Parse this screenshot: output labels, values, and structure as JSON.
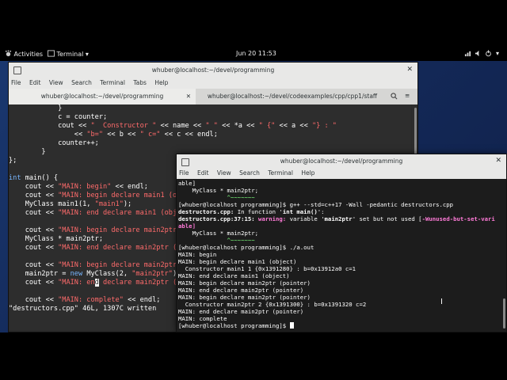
{
  "topbar": {
    "activities": "Activities",
    "app_menu": "Terminal ▾",
    "clock": "Jun 20  11:53"
  },
  "window1": {
    "title": "whuber@localhost:~/devel/programming",
    "menu": [
      "File",
      "Edit",
      "View",
      "Search",
      "Terminal",
      "Tabs",
      "Help"
    ],
    "tabs": [
      {
        "label": "whuber@localhost:~/devel/programming"
      },
      {
        "label": "whuber@localhost:~/devel/codeexamples/cpp/cpp1/staff"
      }
    ],
    "code_lines": [
      "            }",
      "            c = counter;",
      "            cout << \"  Constructor \" << name << \" \" << *a << \" {\" << a << \"} : \"",
      "                << \"b=\" << b << \" c=\" << c << endl;",
      "            counter++;",
      "        }",
      "};",
      "",
      "int main() {",
      "    cout << \"MAIN: begin\" << endl;",
      "    cout << \"MAIN: begin declare main1 (object)\" << endl;",
      "    MyClass main1(1, \"main1\");",
      "    cout << \"MAIN: end declare main1 (object)\" << endl;",
      "",
      "    cout << \"MAIN: begin declare main2ptr (pointer)\" << endl;",
      "    MyClass * main2ptr;",
      "    cout << \"MAIN: end declare main2ptr (pointer)\" << endl;",
      "",
      "    cout << \"MAIN: begin declare main2ptr (pointer)\" << endl;",
      "    main2ptr = new MyClass(2, \"main2ptr\");",
      "    cout << \"MAIN: end declare main2ptr (pointer)\" << endl;",
      "",
      "    cout << \"MAIN: complete\" << endl;",
      "\"destructors.cpp\" 46L, 1307C written"
    ]
  },
  "window2": {
    "title": "whuber@localhost:~/devel/programming",
    "menu": [
      "File",
      "Edit",
      "View",
      "Search",
      "Terminal",
      "Help"
    ],
    "lines": {
      "l1": "able]",
      "l2": "    MyClass * main2ptr;",
      "l3": "              ^~~~~~~~",
      "l4_prompt": "[whuber@localhost programming]$ ",
      "l4_cmd": "g++ --std=c++17 -Wall -pedantic destructors.cpp",
      "l5a": "destructors.cpp:",
      "l5b": " In function '",
      "l5c": "int main()",
      "l5d": "':",
      "l6a": "destructors.cpp:37:15:",
      "l6b": " warning: ",
      "l6c": "variable '",
      "l6d": "main2ptr",
      "l6e": "' set but not used [",
      "l6f": "-Wunused-but-set-vari",
      "l7": "able]",
      "l8": "    MyClass * main2ptr;",
      "l9": "              ^~~~~~~~",
      "l10_prompt": "[whuber@localhost programming]$ ",
      "l10_cmd": "./a.out",
      "out": [
        "MAIN: begin",
        "MAIN: begin declare main1 (object)",
        "  Constructor main1 1 {0x1391280} : b=0x13912a0 c=1",
        "MAIN: end declare main1 (object)",
        "MAIN: begin declare main2ptr (pointer)",
        "MAIN: end declare main2ptr (pointer)",
        "MAIN: begin declare main2ptr (pointer)",
        "  Constructor main2ptr 2 {0x1391300} : b=0x1391320 c=2",
        "MAIN: end declare main2ptr (pointer)",
        "MAIN: complete"
      ],
      "last_prompt": "[whuber@localhost programming]$ "
    }
  },
  "colors": {
    "keyword": "#77b6ff",
    "string": "#ff6b6b",
    "warning": "#ff7bd8",
    "prompt": "#ffffff"
  }
}
